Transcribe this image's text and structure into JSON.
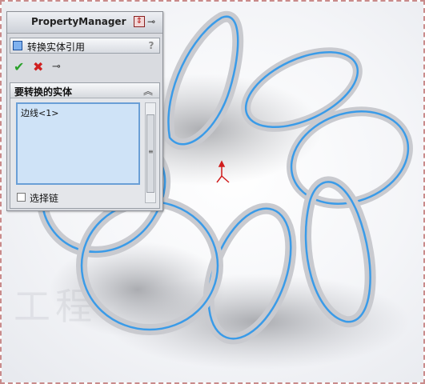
{
  "property_manager": {
    "title": "PropertyManager",
    "feature_name": "转换实体引用",
    "help_label": "?",
    "section": {
      "title": "要转换的实体",
      "items": [
        "边线<1>"
      ],
      "select_chain_label": "选择链",
      "select_chain_checked": false
    }
  },
  "icons": {
    "ok": "checkmark-icon",
    "cancel": "x-icon",
    "pin": "pushpin-icon",
    "collapse": "double-chevron-up-icon"
  },
  "colors": {
    "selection_highlight": "#3a9be8",
    "ok_green": "#2aa12a",
    "cancel_red": "#d02020",
    "list_background": "#cfe3f7"
  }
}
